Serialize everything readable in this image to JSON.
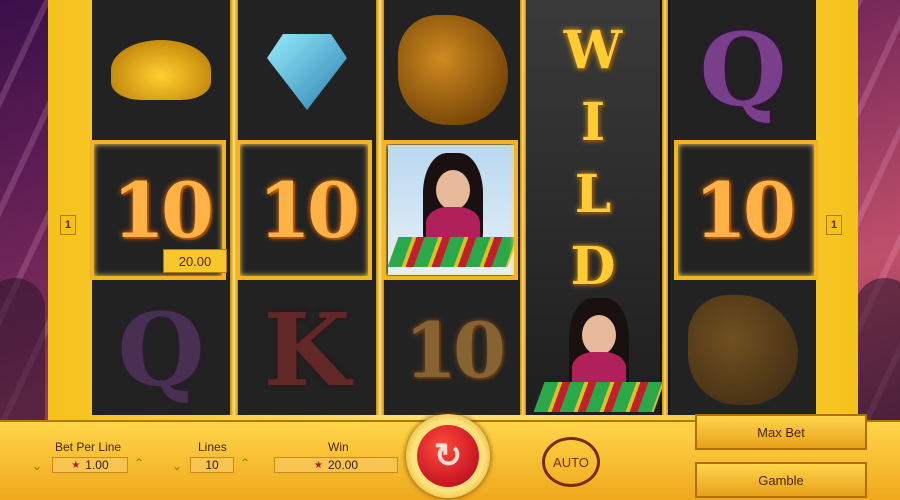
{
  "reels": {
    "win_amount": "20.00",
    "wild_letters": [
      "W",
      "I",
      "L",
      "D"
    ],
    "ten_label": "10",
    "q_label": "Q",
    "k_label": "K"
  },
  "line_marker": "1",
  "controls": {
    "bet_per_line_label": "Bet Per Line",
    "bet_per_line_value": "1.00",
    "lines_label": "Lines",
    "lines_value": "10",
    "win_label": "Win",
    "win_value": "20.00",
    "auto_label": "AUTO",
    "max_bet_label": "Max Bet",
    "gamble_label": "Gamble"
  },
  "icons": {
    "spin": "refresh-icon",
    "star": "star-icon",
    "arrow_down": "chevron-down-icon",
    "arrow_up": "chevron-up-icon"
  },
  "colors": {
    "gold": "#f5c21a",
    "spin_red": "#d0101a",
    "text_brown": "#4a2500"
  }
}
